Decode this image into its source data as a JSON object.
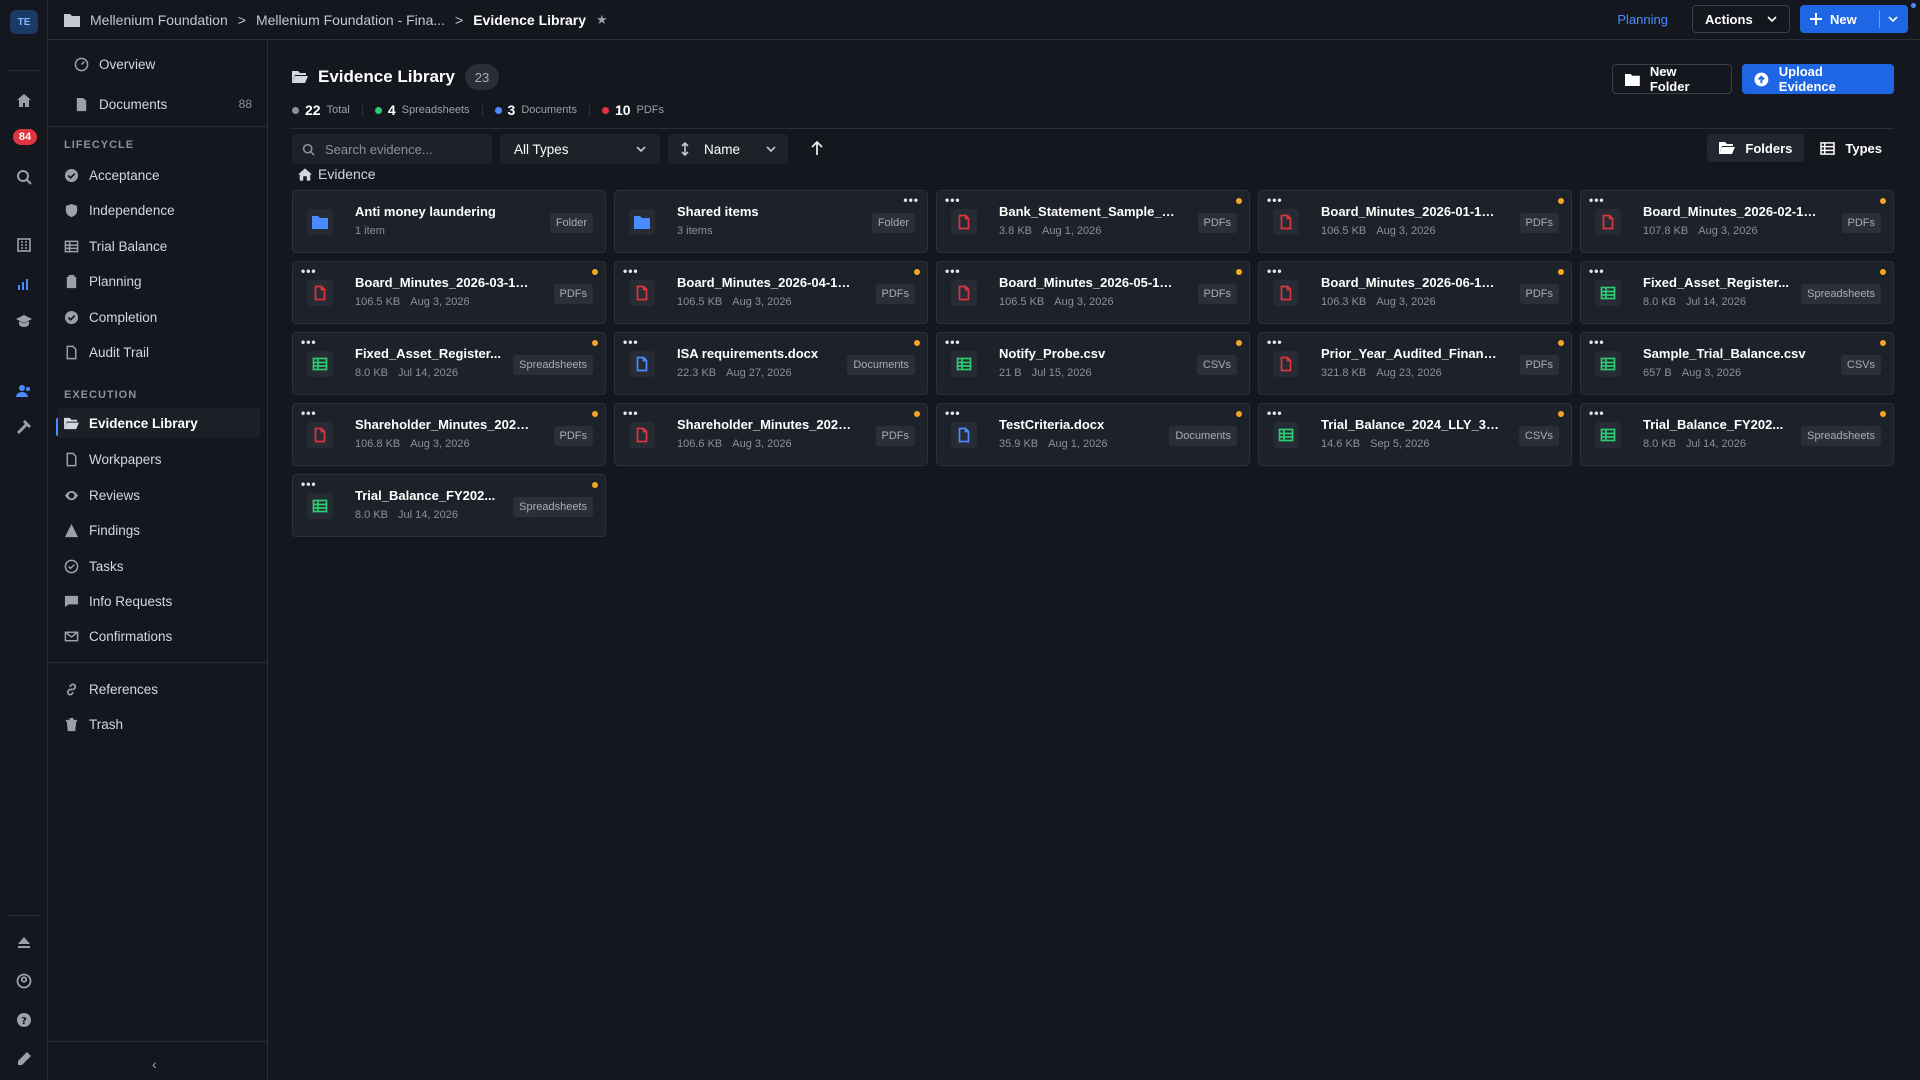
{
  "workspace": "TE",
  "rail": {
    "notification_count": "84"
  },
  "breadcrumb": [
    "Mellenium Foundation",
    "Mellenium Foundation - Fina...",
    "Evidence Library"
  ],
  "topbar": {
    "planning": "Planning",
    "actions": "Actions",
    "new": "New"
  },
  "sidebar": {
    "overview": "Overview",
    "documents": "Documents",
    "documents_count": "88",
    "lifecycle_heading": "LIFECYCLE",
    "lifecycle": [
      "Acceptance",
      "Independence",
      "Trial Balance",
      "Planning",
      "Completion",
      "Audit Trail"
    ],
    "execution_heading": "EXECUTION",
    "execution": [
      "Evidence Library",
      "Workpapers",
      "Reviews",
      "Findings",
      "Tasks",
      "Info Requests",
      "Confirmations"
    ],
    "other": [
      "References",
      "Trash"
    ]
  },
  "library": {
    "title": "Evidence Library",
    "count": "23",
    "stats": [
      {
        "num": "22",
        "label": "Total",
        "color": "#8a919c"
      },
      {
        "num": "4",
        "label": "Spreadsheets",
        "color": "#2ecc71"
      },
      {
        "num": "3",
        "label": "Documents",
        "color": "#4a8cff"
      },
      {
        "num": "10",
        "label": "PDFs",
        "color": "#e0353f"
      }
    ],
    "new_folder": "New Folder",
    "upload": "Upload Evidence"
  },
  "toolbar": {
    "search_placeholder": "Search evidence...",
    "type_filter": "All Types",
    "sort": "Name",
    "folders": "Folders",
    "types": "Types"
  },
  "location": "Evidence",
  "colors": {
    "accent": "#1f66e5",
    "pdf": "#e0353f",
    "sheet": "#2ecc71",
    "doc": "#4a8cff",
    "folder": "#4a8cff",
    "unread": "#f5a623"
  },
  "items": [
    {
      "name": "Anti money laundering",
      "size": "1 item",
      "date": "",
      "tag": "Folder",
      "icon": "folder-icon"
    },
    {
      "name": "Shared items",
      "size": "3 items",
      "date": "",
      "tag": "Folder",
      "icon": "folder-icon"
    },
    {
      "name": "Bank_Statement_Sample_06....",
      "size": "3.8 KB",
      "date": "Aug 1, 2026",
      "tag": "PDFs",
      "icon": "pdf-icon"
    },
    {
      "name": "Board_Minutes_2026-01-15.p...",
      "size": "106.5 KB",
      "date": "Aug 3, 2026",
      "tag": "PDFs",
      "icon": "pdf-icon"
    },
    {
      "name": "Board_Minutes_2026-02-12....",
      "size": "107.8 KB",
      "date": "Aug 3, 2026",
      "tag": "PDFs",
      "icon": "pdf-icon"
    },
    {
      "name": "Board_Minutes_2026-03-12....",
      "size": "106.5 KB",
      "date": "Aug 3, 2026",
      "tag": "PDFs",
      "icon": "pdf-icon"
    },
    {
      "name": "Board_Minutes_2026-04-16....",
      "size": "106.5 KB",
      "date": "Aug 3, 2026",
      "tag": "PDFs",
      "icon": "pdf-icon"
    },
    {
      "name": "Board_Minutes_2026-05-14....",
      "size": "106.5 KB",
      "date": "Aug 3, 2026",
      "tag": "PDFs",
      "icon": "pdf-icon"
    },
    {
      "name": "Board_Minutes_2026-06-18....",
      "size": "106.3 KB",
      "date": "Aug 3, 2026",
      "tag": "PDFs",
      "icon": "pdf-icon"
    },
    {
      "name": "Fixed_Asset_Register...",
      "size": "8.0 KB",
      "date": "Jul 14, 2026",
      "tag": "Spreadsheets",
      "icon": "spreadsheet-icon"
    },
    {
      "name": "Fixed_Asset_Register...",
      "size": "8.0 KB",
      "date": "Jul 14, 2026",
      "tag": "Spreadsheets",
      "icon": "spreadsheet-icon"
    },
    {
      "name": "ISA requirements.docx",
      "size": "22.3 KB",
      "date": "Aug 27, 2026",
      "tag": "Documents",
      "icon": "document-icon"
    },
    {
      "name": "Notify_Probe.csv",
      "size": "21 B",
      "date": "Jul 15, 2026",
      "tag": "CSVs",
      "icon": "spreadsheet-icon"
    },
    {
      "name": "Prior_Year_Audited_Financial...",
      "size": "321.8 KB",
      "date": "Aug 23, 2026",
      "tag": "PDFs",
      "icon": "pdf-icon"
    },
    {
      "name": "Sample_Trial_Balance.csv",
      "size": "657 B",
      "date": "Aug 3, 2026",
      "tag": "CSVs",
      "icon": "spreadsheet-icon"
    },
    {
      "name": "Shareholder_Minutes_2026-0...",
      "size": "106.8 KB",
      "date": "Aug 3, 2026",
      "tag": "PDFs",
      "icon": "pdf-icon"
    },
    {
      "name": "Shareholder_Minutes_2026-0...",
      "size": "106.6 KB",
      "date": "Aug 3, 2026",
      "tag": "PDFs",
      "icon": "pdf-icon"
    },
    {
      "name": "TestCriteria.docx",
      "size": "35.9 KB",
      "date": "Aug 1, 2026",
      "tag": "Documents",
      "icon": "document-icon"
    },
    {
      "name": "Trial_Balance_2024_LLY_300...",
      "size": "14.6 KB",
      "date": "Sep 5, 2026",
      "tag": "CSVs",
      "icon": "spreadsheet-icon"
    },
    {
      "name": "Trial_Balance_FY202...",
      "size": "8.0 KB",
      "date": "Jul 14, 2026",
      "tag": "Spreadsheets",
      "icon": "spreadsheet-icon"
    },
    {
      "name": "Trial_Balance_FY202...",
      "size": "8.0 KB",
      "date": "Jul 14, 2026",
      "tag": "Spreadsheets",
      "icon": "spreadsheet-icon"
    }
  ]
}
